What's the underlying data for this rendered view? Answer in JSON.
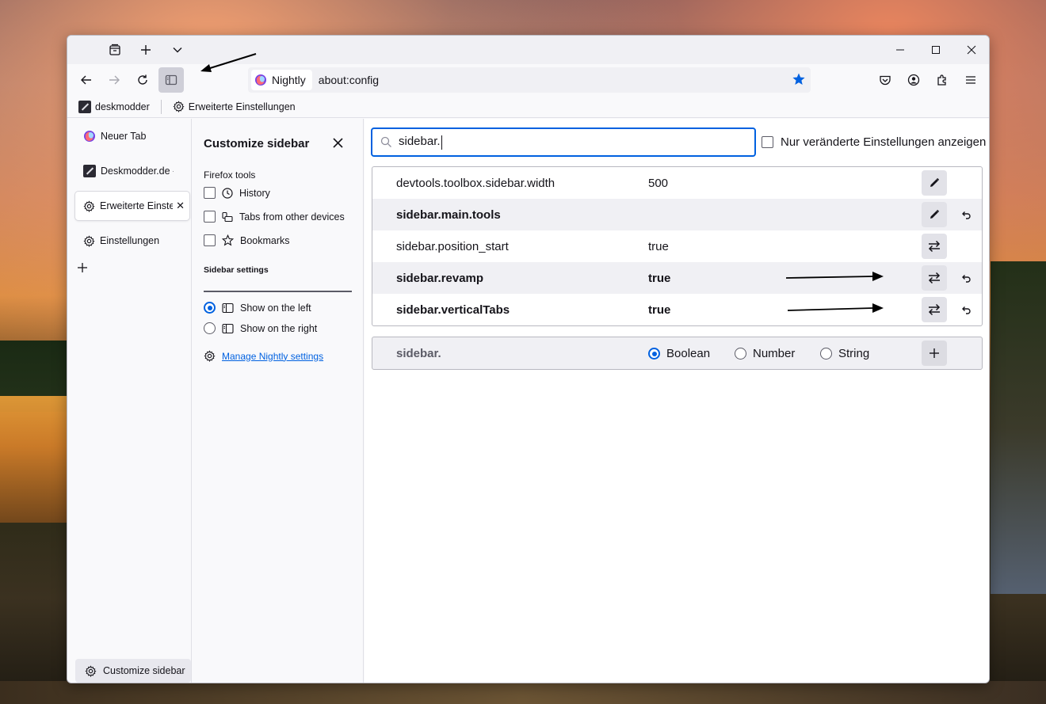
{
  "browser": {
    "identity_label": "Nightly",
    "url": "about:config",
    "bookmarks": [
      "deskmodder",
      "Erweiterte Einstellungen"
    ]
  },
  "vertical_tabs": {
    "tabs": [
      {
        "label": "Neuer Tab",
        "icon": "nightly-icon"
      },
      {
        "label": "Deskmodder.de - N",
        "icon": "deskmodder-icon"
      },
      {
        "label": "Erweiterte Einste",
        "icon": "gear-icon",
        "selected": true
      },
      {
        "label": "Einstellungen",
        "icon": "gear-icon"
      }
    ],
    "customize_label": "Customize sidebar"
  },
  "panel": {
    "title": "Customize sidebar",
    "firefox_tools_heading": "Firefox tools",
    "tools": [
      {
        "label": "History",
        "checked": false,
        "icon": "clock-icon"
      },
      {
        "label": "Tabs from other devices",
        "checked": false,
        "icon": "synced-tabs-icon"
      },
      {
        "label": "Bookmarks",
        "checked": false,
        "icon": "star-icon"
      }
    ],
    "sidebar_settings_heading": "Sidebar settings",
    "positions": [
      {
        "label": "Show on the left",
        "checked": true
      },
      {
        "label": "Show on the right",
        "checked": false
      }
    ],
    "manage_link": "Manage Nightly settings"
  },
  "config": {
    "search_value": "sidebar.",
    "only_modified_label": "Nur veränderte Einstellungen anzeigen",
    "prefs": [
      {
        "name": "devtools.toolbox.sidebar.width",
        "value": "500",
        "modified": false,
        "action": "edit"
      },
      {
        "name": "sidebar.main.tools",
        "value": "",
        "modified": true,
        "action": "edit"
      },
      {
        "name": "sidebar.position_start",
        "value": "true",
        "modified": false,
        "action": "toggle"
      },
      {
        "name": "sidebar.revamp",
        "value": "true",
        "modified": true,
        "action": "toggle"
      },
      {
        "name": "sidebar.verticalTabs",
        "value": "true",
        "modified": true,
        "action": "toggle"
      }
    ],
    "new_pref": {
      "name": "sidebar.",
      "types": [
        {
          "label": "Boolean",
          "checked": true
        },
        {
          "label": "Number",
          "checked": false
        },
        {
          "label": "String",
          "checked": false
        }
      ]
    }
  },
  "colors": {
    "accent": "#0061e0",
    "nightly_logo": "#7542e5"
  }
}
